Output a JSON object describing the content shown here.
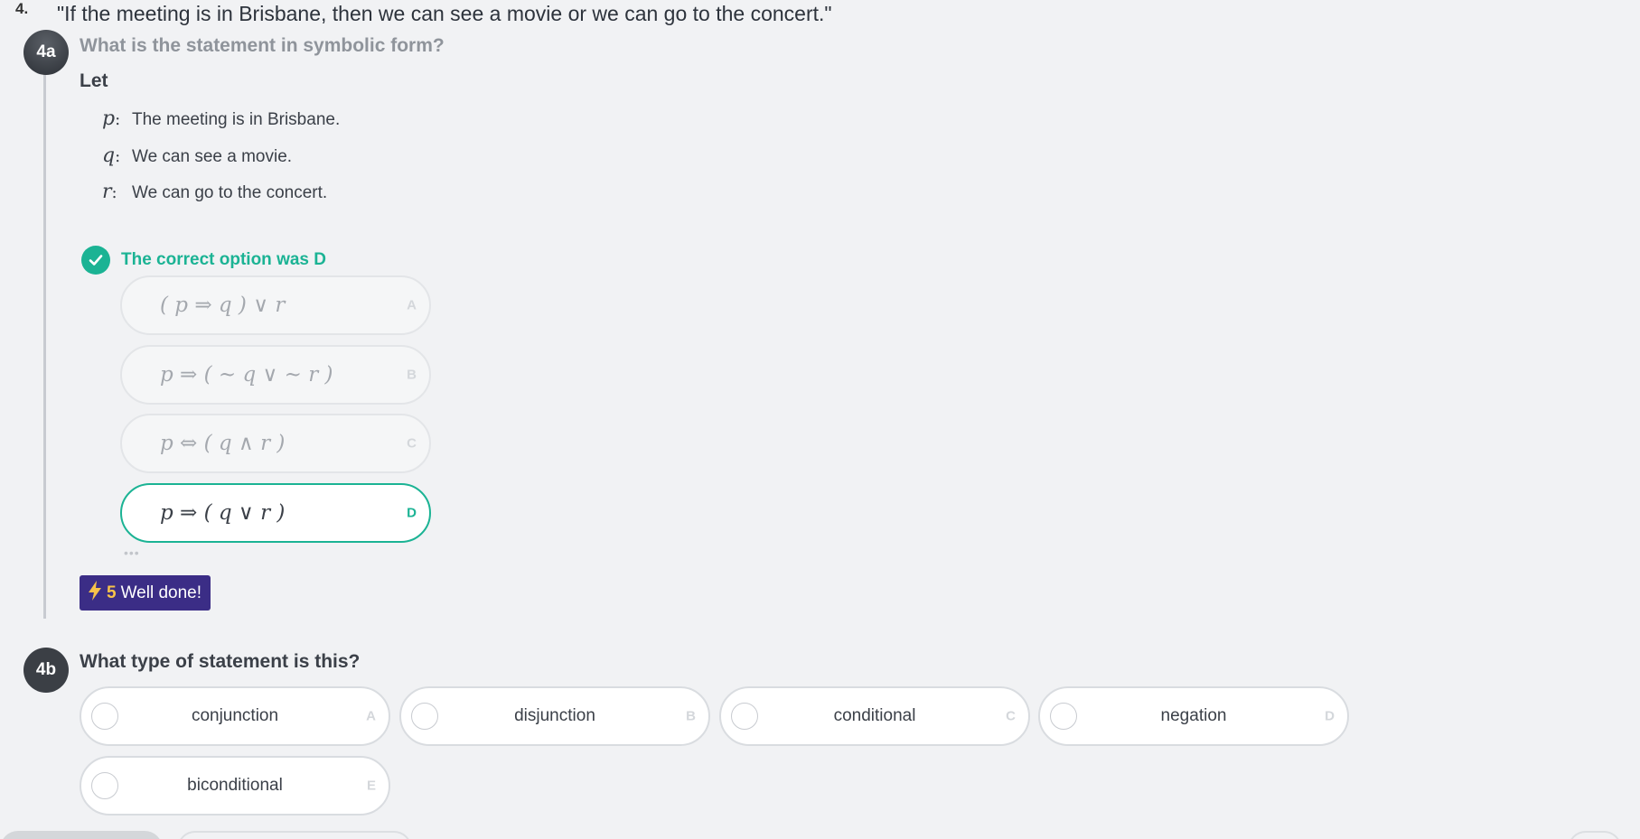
{
  "question": {
    "number": "4.",
    "statement": "\"If the meeting is in Brisbane, then we can see a movie or we can go to the concert.\""
  },
  "part_a": {
    "badge": "4a",
    "prompt": "What is the statement in symbolic form?",
    "let_label": "Let",
    "definitions": [
      {
        "var": "p",
        "colon": ":",
        "text": "The meeting is in Brisbane."
      },
      {
        "var": "q",
        "colon": ":",
        "text": "We can see a movie."
      },
      {
        "var": "r",
        "colon": ":",
        "text": "We can go to the concert."
      }
    ],
    "feedback": "The correct option was D",
    "options": [
      {
        "expr": "( p ⇒ q ) ∨ r",
        "letter": "A"
      },
      {
        "expr": "p ⇒ ( ~ q ∨ ~ r )",
        "letter": "B"
      },
      {
        "expr": "p ⇔ ( q ∧ r )",
        "letter": "C"
      },
      {
        "expr": "p ⇒ ( q ∨ r )",
        "letter": "D"
      }
    ],
    "more_dots": "•••",
    "reward": {
      "points": "5",
      "message": "Well done!"
    }
  },
  "part_b": {
    "badge": "4b",
    "prompt": "What type of statement is this?",
    "choices": [
      {
        "label": "conjunction",
        "letter": "A"
      },
      {
        "label": "disjunction",
        "letter": "B"
      },
      {
        "label": "conditional",
        "letter": "C"
      },
      {
        "label": "negation",
        "letter": "D"
      },
      {
        "label": "biconditional",
        "letter": "E"
      }
    ]
  },
  "colors": {
    "correct": "#1bb394",
    "reward_bg": "#3b2d86",
    "reward_points": "#f7c34a",
    "badge": "#3b3f45"
  }
}
